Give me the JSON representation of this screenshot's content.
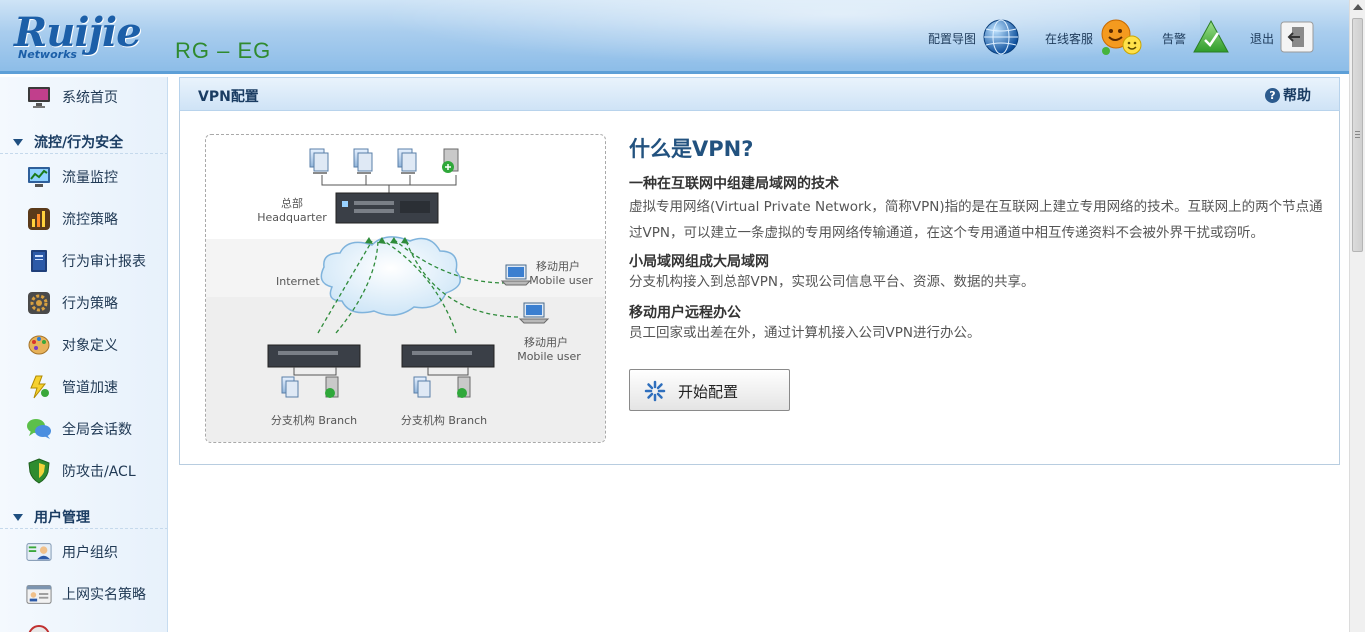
{
  "header": {
    "logo_text": "Ruijie",
    "logo_sub": "Networks",
    "product": "RG – EG",
    "links": [
      {
        "label": "配置导图",
        "icon": "globe-icon"
      },
      {
        "label": "在线客服",
        "icon": "smiley-icon"
      },
      {
        "label": "告警",
        "icon": "alert-triangle-icon"
      },
      {
        "label": "退出",
        "icon": "logout-icon"
      }
    ]
  },
  "sidebar": {
    "home": {
      "label": "系统首页",
      "icon": "monitor-icon"
    },
    "sections": [
      {
        "title": "流控/行为安全",
        "items": [
          {
            "label": "流量监控",
            "icon": "traffic-monitor-icon"
          },
          {
            "label": "流控策略",
            "icon": "bar-chart-icon"
          },
          {
            "label": "行为审计报表",
            "icon": "book-icon"
          },
          {
            "label": "行为策略",
            "icon": "gear-icon"
          },
          {
            "label": "对象定义",
            "icon": "palette-icon"
          },
          {
            "label": "管道加速",
            "icon": "lightning-icon"
          },
          {
            "label": "全局会话数",
            "icon": "chat-icon"
          },
          {
            "label": "防攻击/ACL",
            "icon": "shield-icon"
          }
        ]
      },
      {
        "title": "用户管理",
        "items": [
          {
            "label": "用户组织",
            "icon": "user-org-icon"
          },
          {
            "label": "上网实名策略",
            "icon": "id-card-icon"
          }
        ]
      }
    ]
  },
  "main": {
    "title": "VPN配置",
    "help_label": "帮助",
    "heading": "什么是VPN?",
    "blocks": [
      {
        "title": "一种在互联网中组建局域网的技术",
        "text": "虚拟专用网络(Virtual Private Network，简称VPN)指的是在互联网上建立专用网络的技术。互联网上的两个节点通过VPN，可以建立一条虚拟的专用网络传输通道，在这个专用通道中相互传递资料不会被外界干扰或窃听。"
      },
      {
        "title": "小局域网组成大局域网",
        "text": "分支机构接入到总部VPN，实现公司信息平台、资源、数据的共享。"
      },
      {
        "title": "移动用户远程办公",
        "text": "员工回家或出差在外，通过计算机接入公司VPN进行办公。"
      }
    ],
    "start_button": "开始配置",
    "diagram": {
      "hq_cn": "总部",
      "hq_en": "Headquarter",
      "internet": "Internet",
      "mobile_cn": "移动用户",
      "mobile_en": "Mobile user",
      "branch": "分支机构 Branch"
    }
  },
  "colors": {
    "header_blue": "#8dbde8",
    "title_blue": "#22527f",
    "product_green": "#2f8a2f",
    "dashed_link": "#2e8b3a"
  }
}
